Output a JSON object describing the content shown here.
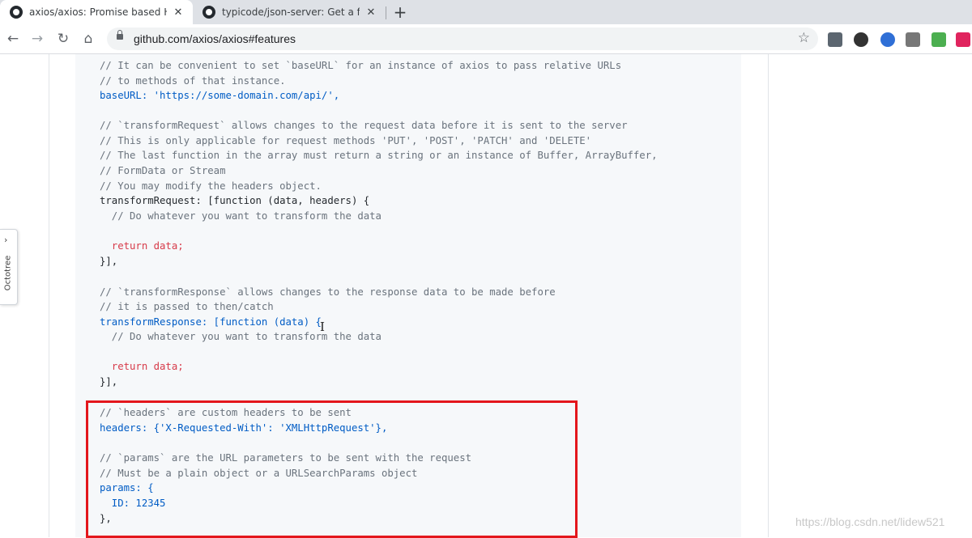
{
  "browser": {
    "tabs": [
      {
        "title": "axios/axios: Promise based HT",
        "close": "✕",
        "active": true
      },
      {
        "title": "typicode/json-server: Get a ful",
        "close": "✕",
        "active": false
      }
    ],
    "new_tab": "+",
    "nav": {
      "back": "←",
      "forward": "→",
      "reload": "↻",
      "home": "⌂"
    },
    "url": "github.com/axios/axios#features",
    "bookmark_star": "☆"
  },
  "sidebar": {
    "label": "Octotree",
    "chevron": "›"
  },
  "code": {
    "lines": [
      "// It can be convenient to set `baseURL` for an instance of axios to pass relative URLs",
      "// to methods of that instance.",
      "baseURL: 'https://some-domain.com/api/',",
      "",
      "// `transformRequest` allows changes to the request data before it is sent to the server",
      "// This is only applicable for request methods 'PUT', 'POST', 'PATCH' and 'DELETE'",
      "// The last function in the array must return a string or an instance of Buffer, ArrayBuffer,",
      "// FormData or Stream",
      "// You may modify the headers object.",
      "transformRequest: [function (data, headers) {",
      "  // Do whatever you want to transform the data",
      "",
      "  return data;",
      "}],",
      "",
      "// `transformResponse` allows changes to the response data to be made before",
      "// it is passed to then/catch",
      "transformResponse: [function (data) {",
      "  // Do whatever you want to transform the data",
      "",
      "  return data;",
      "}],",
      "",
      "// `headers` are custom headers to be sent",
      "headers: {'X-Requested-With': 'XMLHttpRequest'},",
      "",
      "// `params` are the URL parameters to be sent with the request",
      "// Must be a plain object or a URLSearchParams object",
      "params: {",
      "  ID: 12345",
      "},"
    ]
  },
  "watermark": "https://blog.csdn.net/lidew521",
  "colors": {
    "highlight_box": "#e3161c",
    "comment": "#6a737d",
    "keyword": "#d73a49",
    "property": "#005cc5",
    "string": "#032f62",
    "search_highlight": "#ffe27a"
  }
}
